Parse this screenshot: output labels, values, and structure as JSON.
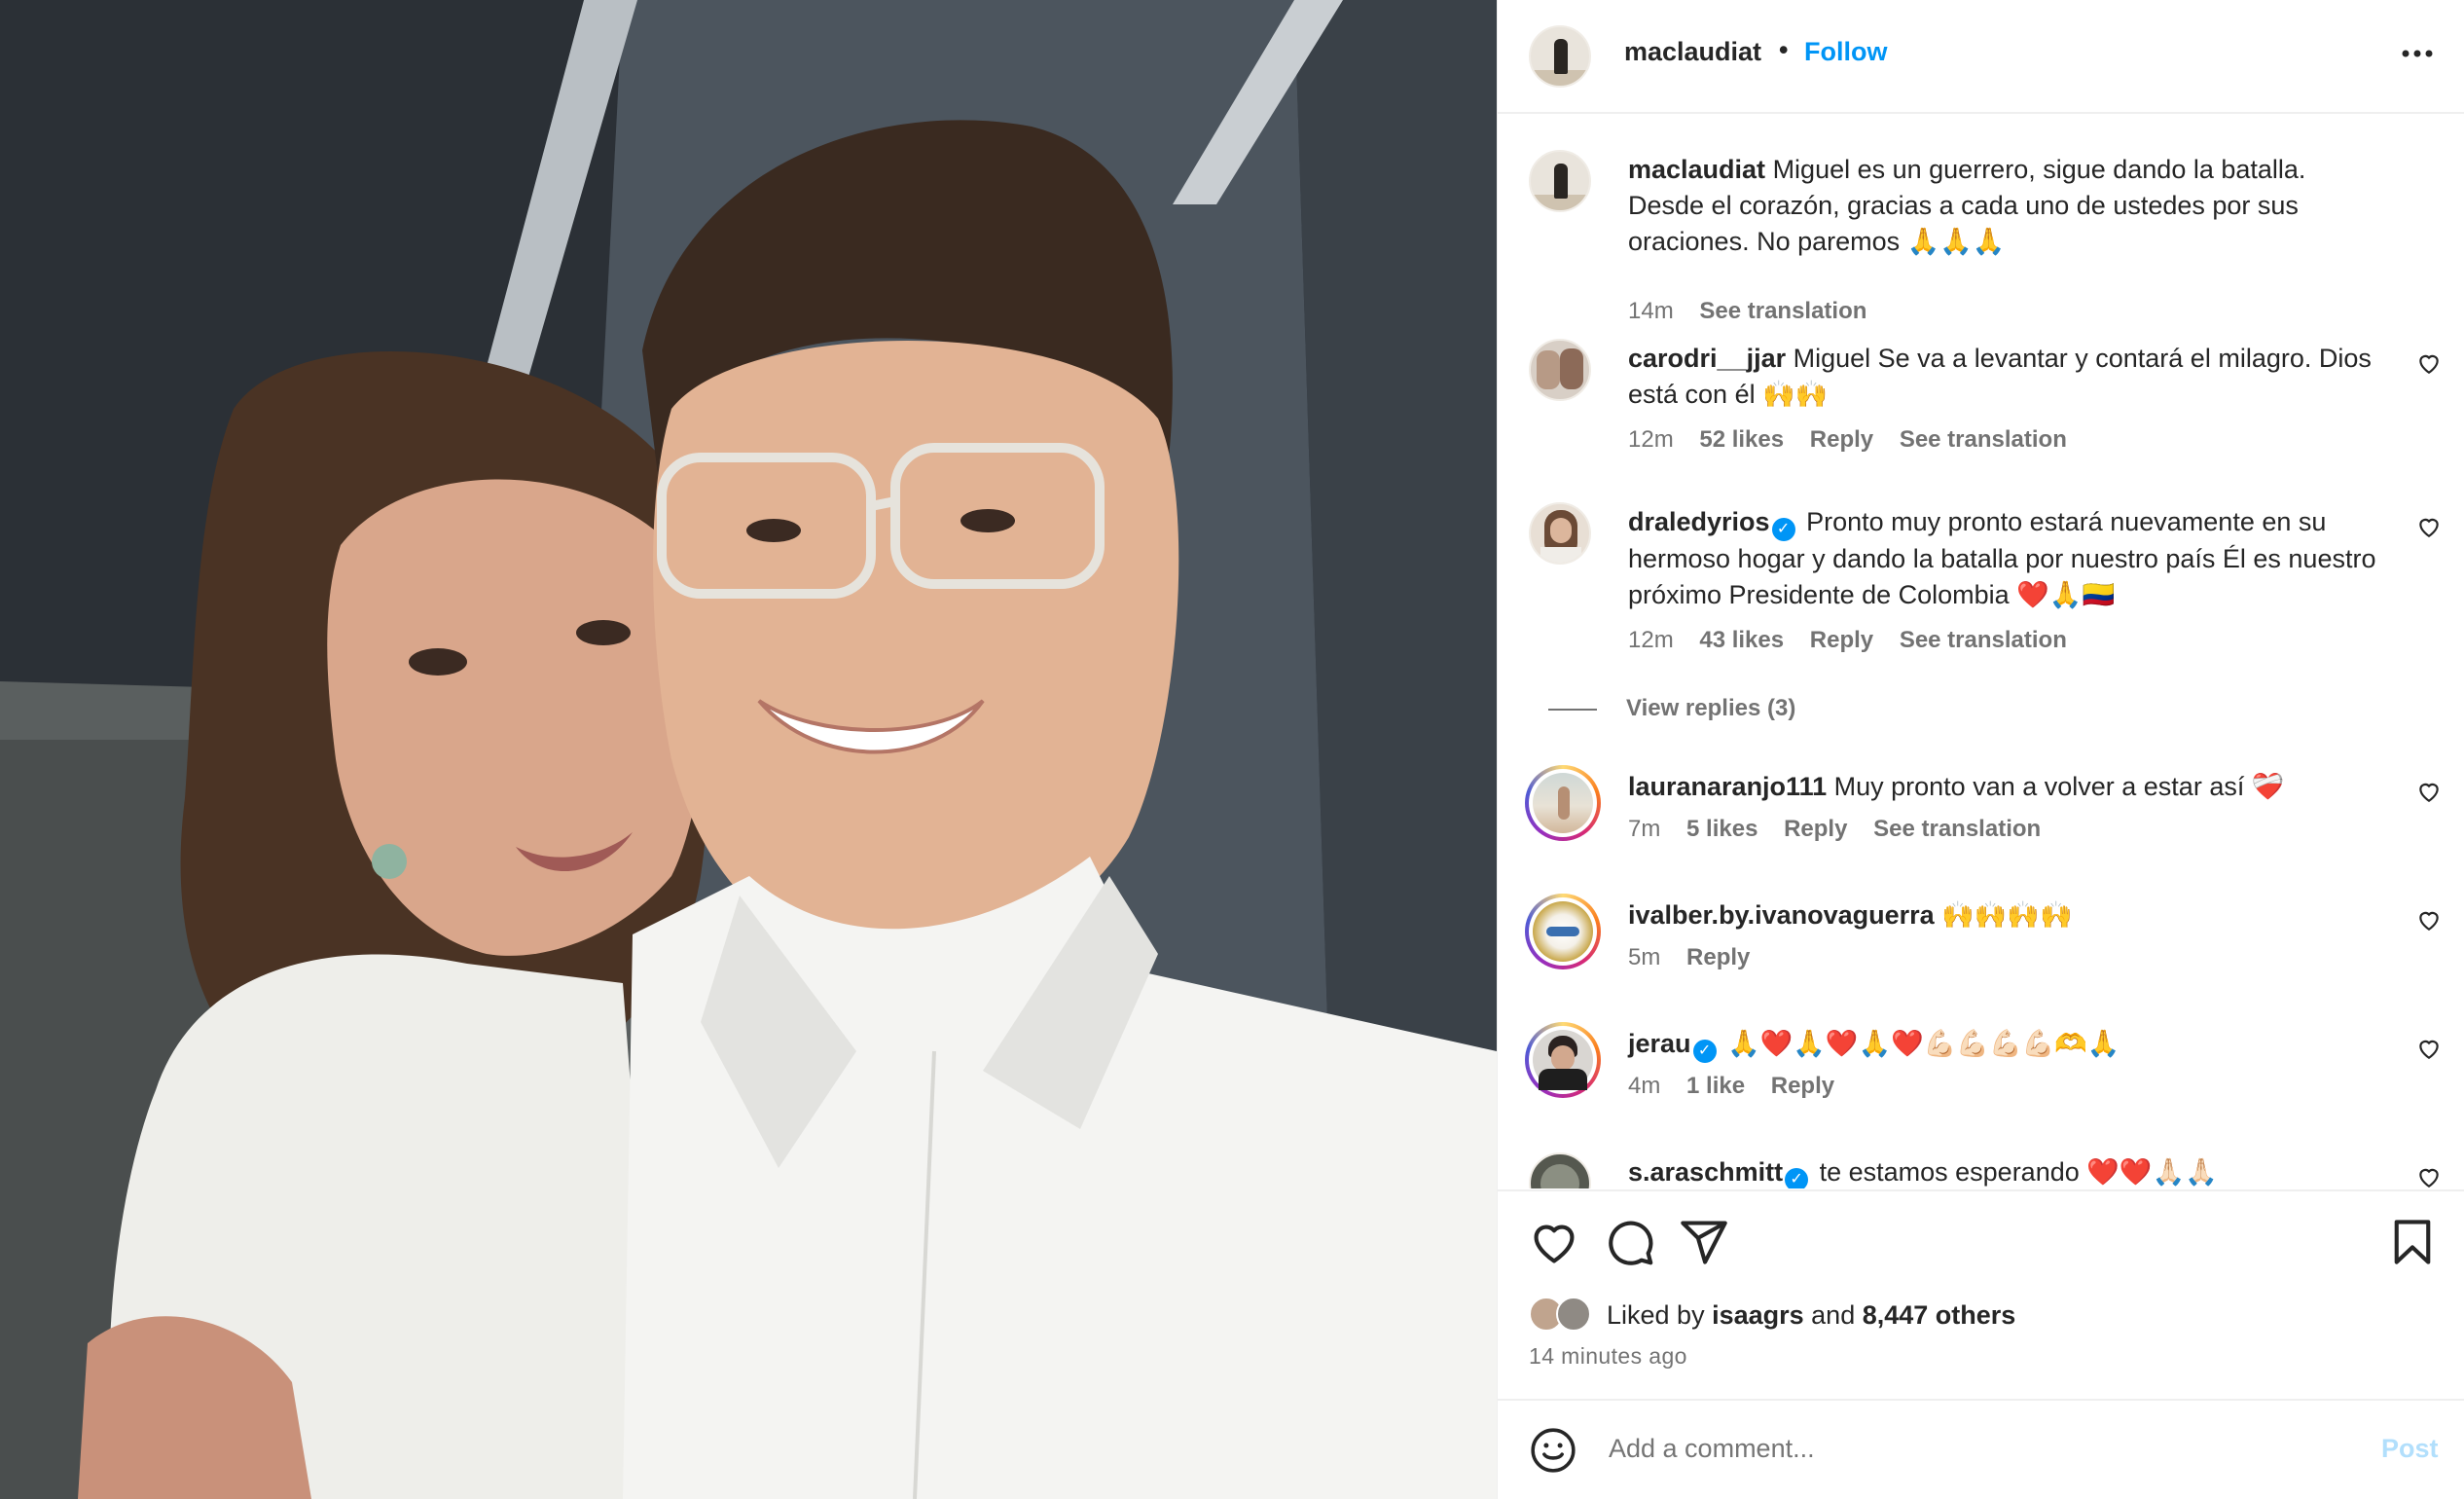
{
  "post": {
    "author": "maclaudiat",
    "follow_label": "Follow",
    "dot": "•",
    "more_icon": "more-horizontal-icon"
  },
  "caption": {
    "user": "maclaudiat",
    "text": " Miguel es un guerrero, sigue dando la batalla. Desde el corazón, gracias a cada uno de ustedes por sus oraciones. No paremos ",
    "emoji": "🙏🙏🙏",
    "time": "14m",
    "translation": "See translation"
  },
  "comments": [
    {
      "user": "carodri__jjar",
      "verified": false,
      "text": " Miguel Se va a levantar y contará el milagro. Dios está con él ",
      "emoji": "🙌🙌",
      "time": "12m",
      "likes": "52 likes",
      "reply": "Reply",
      "translation": "See translation"
    },
    {
      "user": "draledyrios",
      "verified": true,
      "text": " Pronto muy pronto estará nuevamente en su hermoso hogar y dando la batalla por nuestro país Él es nuestro próximo Presidente de Colombia ",
      "emoji": "❤️🙏🇨🇴",
      "time": "12m",
      "likes": "43 likes",
      "reply": "Reply",
      "translation": "See translation",
      "view_replies": "View replies (3)"
    },
    {
      "user": "lauranaranjo111",
      "verified": false,
      "text": " Muy pronto van a volver a estar así ",
      "emoji": "❤️‍🩹",
      "time": "7m",
      "likes": "5 likes",
      "reply": "Reply",
      "translation": "See translation"
    },
    {
      "user": "ivalber.by.ivanovaguerra",
      "verified": false,
      "text": " ",
      "emoji": "🙌🙌🙌🙌",
      "time": "5m",
      "likes": "",
      "reply": "Reply",
      "translation": ""
    },
    {
      "user": "jerau",
      "verified": true,
      "text": " ",
      "emoji": "🙏❤️🙏❤️🙏❤️💪🏻💪🏻💪🏻💪🏻🫶🙏",
      "time": "4m",
      "likes": "1 like",
      "reply": "Reply",
      "translation": ""
    },
    {
      "user": "s.araschmitt",
      "verified": true,
      "text": " te estamos esperando ",
      "emoji": "❤️❤️🙏🏻🙏🏻",
      "time": "",
      "likes": "",
      "reply": "",
      "translation": ""
    }
  ],
  "likes": {
    "prefix": "Liked by ",
    "user": "isaagrs",
    "and": " and ",
    "others": "8,447 others"
  },
  "time_ago": "14 minutes ago",
  "add_comment": {
    "placeholder": "Add a comment...",
    "post_label": "Post"
  },
  "colors": {
    "link": "#0095f6",
    "text": "#262626",
    "muted": "#737373",
    "post_disabled": "#b2dffc"
  }
}
